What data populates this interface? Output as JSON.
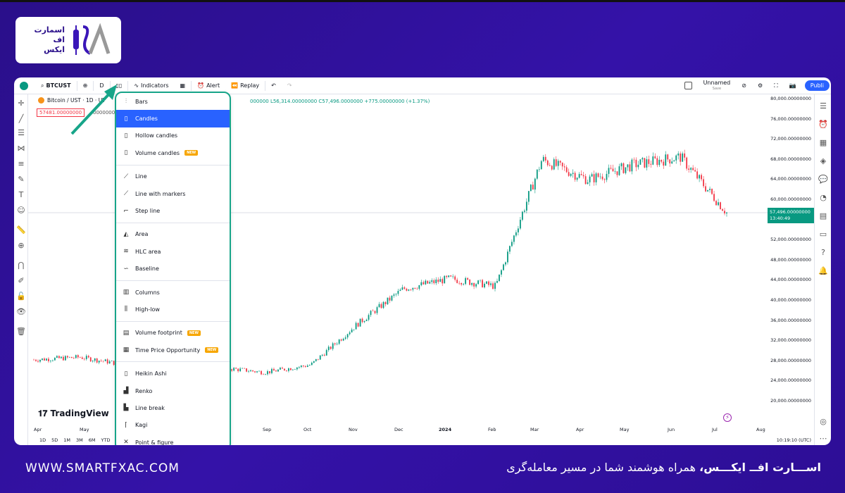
{
  "brand": {
    "logo_lines": [
      "اسمارت",
      "اف",
      "ایکس"
    ],
    "footer_url": "WWW.SMARTFXAC.COM",
    "footer_tagline_bold": "اســـارت افــ ایکـــس،",
    "footer_tagline_rest": " همراه هوشمند شما در مسیر معامله‌گری"
  },
  "toolbar": {
    "symbol": "BTCUST",
    "interval": "D",
    "indicators_label": "Indicators",
    "alert_label": "Alert",
    "replay_label": "Replay",
    "layout_name": "Unnamed",
    "layout_sub": "Save",
    "publish_label": "Publi"
  },
  "legend": {
    "title": "Bitcoin / UST · 1D · UT",
    "ohlc": "000000  L56,314.00000000  C57,496.0000000  +775.00000000 (+1.37%)",
    "crosshair_price": "57481.00000000",
    "left_value": "00000000"
  },
  "chart_type_menu": {
    "items": [
      {
        "label": "Bars",
        "icon": "bars-icon",
        "glyph": "⫶"
      },
      {
        "label": "Candles",
        "icon": "candles-icon",
        "glyph": "▯",
        "active": true
      },
      {
        "label": "Hollow candles",
        "icon": "hollow-candles-icon",
        "glyph": "▯"
      },
      {
        "label": "Volume candles",
        "icon": "volume-candles-icon",
        "glyph": "▯",
        "badge": "NEW"
      },
      {
        "sep": true
      },
      {
        "label": "Line",
        "icon": "line-icon",
        "glyph": "⟋"
      },
      {
        "label": "Line with markers",
        "icon": "line-markers-icon",
        "glyph": "⟋"
      },
      {
        "label": "Step line",
        "icon": "step-line-icon",
        "glyph": "⌐"
      },
      {
        "sep": true
      },
      {
        "label": "Area",
        "icon": "area-icon",
        "glyph": "◭"
      },
      {
        "label": "HLC area",
        "icon": "hlc-area-icon",
        "glyph": "≋"
      },
      {
        "label": "Baseline",
        "icon": "baseline-icon",
        "glyph": "∽"
      },
      {
        "sep": true
      },
      {
        "label": "Columns",
        "icon": "columns-icon",
        "glyph": "▥"
      },
      {
        "label": "High-low",
        "icon": "high-low-icon",
        "glyph": "⫼"
      },
      {
        "sep": true
      },
      {
        "label": "Volume footprint",
        "icon": "volume-footprint-icon",
        "glyph": "▤",
        "badge": "NEW"
      },
      {
        "label": "Time Price Opportunity",
        "icon": "tpo-icon",
        "glyph": "▦",
        "badge": "NEW"
      },
      {
        "sep": true
      },
      {
        "label": "Heikin Ashi",
        "icon": "heikin-ashi-icon",
        "glyph": "▯"
      },
      {
        "label": "Renko",
        "icon": "renko-icon",
        "glyph": "▟"
      },
      {
        "label": "Line break",
        "icon": "line-break-icon",
        "glyph": "▙"
      },
      {
        "label": "Kagi",
        "icon": "kagi-icon",
        "glyph": "⌈"
      },
      {
        "label": "Point & figure",
        "icon": "point-figure-icon",
        "glyph": "✕"
      }
    ]
  },
  "y_axis": [
    "80,000.00000000",
    "76,000.00000000",
    "72,000.00000000",
    "68,000.00000000",
    "64,000.00000000",
    "60,000.00000000",
    "56,000.00000000",
    "52,000.00000000",
    "48,000.00000000",
    "44,000.00000000",
    "40,000.00000000",
    "36,000.00000000",
    "32,000.00000000",
    "28,000.00000000",
    "24,000.00000000",
    "20,000.00000000"
  ],
  "current_price": {
    "value": "57,496.00000000",
    "countdown": "13:40:49"
  },
  "x_axis": [
    "Apr",
    "May",
    "Sep",
    "Oct",
    "Nov",
    "Dec",
    "2024",
    "Feb",
    "Mar",
    "Apr",
    "May",
    "Jun",
    "Jul",
    "Aug"
  ],
  "bottom_bar": {
    "ranges": [
      "1D",
      "5D",
      "1M",
      "3M",
      "6M",
      "YTD"
    ],
    "clock": "10:19:10 (UTC)"
  },
  "watermark": "TradingView",
  "chart_data": {
    "type": "line",
    "title": "Bitcoin / UST",
    "xlabel": "",
    "ylabel": "",
    "ylim": [
      18000,
      80000
    ],
    "x": [
      "Apr",
      "May",
      "Jun",
      "Jul",
      "Aug",
      "Sep",
      "Oct",
      "Nov",
      "Dec",
      "2024",
      "Feb",
      "Mar",
      "Apr",
      "May",
      "Jun",
      "Jul"
    ],
    "series": [
      {
        "values": [
          28500,
          29000,
          27500,
          30500,
          27000,
          26000,
          27500,
          35500,
          42500,
          44500,
          43000,
          68000,
          64000,
          67000,
          68500,
          57496
        ]
      }
    ],
    "colors": {
      "up": "#089981",
      "down": "#f23645"
    }
  }
}
